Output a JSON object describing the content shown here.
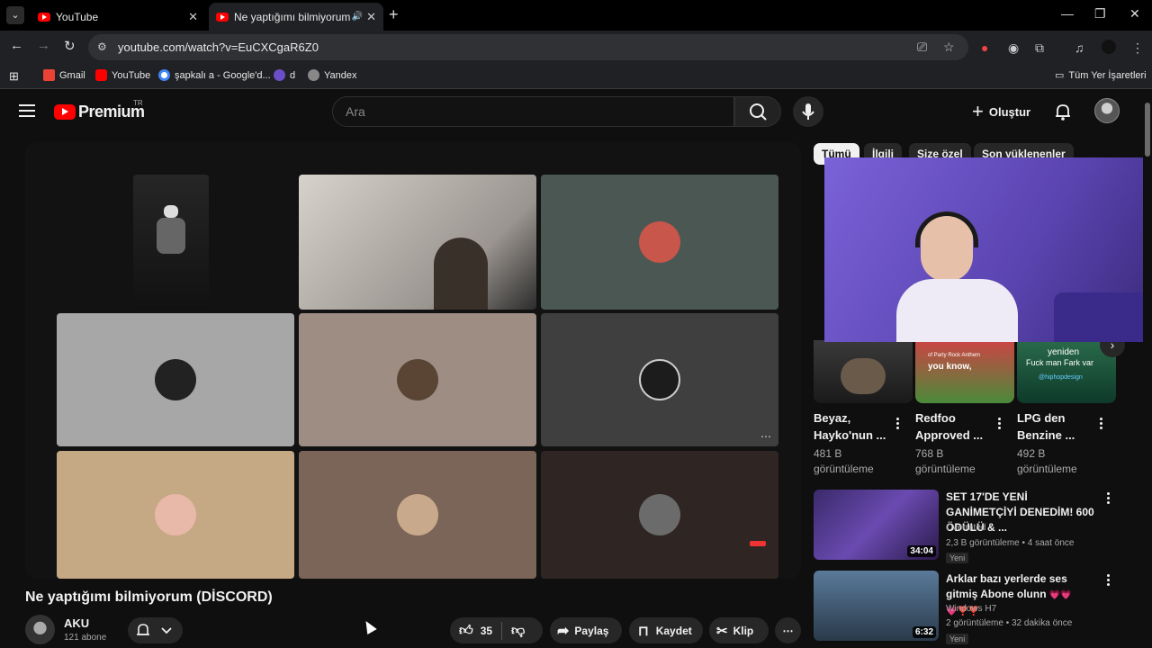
{
  "browser": {
    "tabs": [
      {
        "label": "YouTube",
        "active": false
      },
      {
        "label": "Ne yaptığımı bilmiyorum (D",
        "active": true
      }
    ],
    "url": "youtube.com/watch?v=EuCXCgaR6Z0",
    "bookmarks": [
      "Gmail",
      "YouTube",
      "şapkalı a - Google'd...",
      "d",
      "Yandex"
    ],
    "all_bookmarks": "Tüm Yer İşaretleri"
  },
  "header": {
    "logo": "Premium",
    "region": "TR",
    "search_placeholder": "Ara",
    "create": "Oluştur"
  },
  "video": {
    "title": "Ne yaptığımı bilmiyorum (DİSCORD)",
    "channel": "AKU",
    "subscribers": "121 abone",
    "likes": "35",
    "share": "Paylaş",
    "save": "Kaydet",
    "clip": "Klip"
  },
  "chips": [
    "Tümü",
    "İlgili",
    "Size özel",
    "Son yüklenenler"
  ],
  "shorts": [
    {
      "title": "Beyaz, Hayko'nun ...",
      "views": "481 B görüntüleme",
      "overlay": ""
    },
    {
      "title": "Redfoo Approved ...",
      "views": "768 B görüntüleme",
      "overlay": "you know,"
    },
    {
      "title": "LPG den Benzine ...",
      "views": "492 B görüntüleme",
      "overlay": "Fuck man Fark var"
    }
  ],
  "short_top_labels": {
    "party": "of Party Rock Anthem",
    "yeniden": "yeniden",
    "handle": "@hiphopdesign"
  },
  "recommended": [
    {
      "title": "SET 17'DE YENİ GANİMETÇİYİ DENEDİM! 600 ÖDÜLÜ & ...",
      "channel": "Overrated",
      "meta": "2,3 B görüntüleme • 4 saat önce",
      "badge": "Yeni",
      "duration": "34:04"
    },
    {
      "title": "Arklar bazı yerlerde ses gitmiş Abone olunn",
      "hearts": "💗💗💗❣️❣️",
      "channel": "Windows H7",
      "meta": "2 görüntüleme • 32 dakika önce",
      "badge": "Yeni",
      "duration": "6:32"
    }
  ],
  "colors": {
    "brand_red": "#ff0000",
    "bg": "#0f0f0f",
    "chip": "#272727"
  }
}
